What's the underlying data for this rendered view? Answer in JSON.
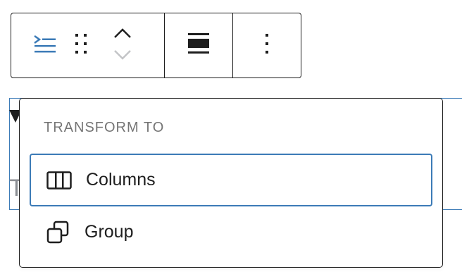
{
  "toolbar": {
    "buttons": [
      {
        "name": "list-view-icon",
        "color": "#3c7bb7"
      },
      {
        "name": "drag-handle-icon"
      },
      {
        "name": "move-up-icon"
      },
      {
        "name": "move-down-icon",
        "disabled": true
      },
      {
        "name": "align-wide-icon"
      },
      {
        "name": "more-options-icon"
      }
    ]
  },
  "popover": {
    "title": "TRANSFORM TO",
    "items": [
      {
        "label": "Columns",
        "icon": "columns-icon",
        "highlighted": true
      },
      {
        "label": "Group",
        "icon": "group-icon",
        "highlighted": false
      }
    ]
  },
  "colors": {
    "accent": "#3c7bb7",
    "text": "#1e1e1e",
    "muted": "#757575"
  }
}
